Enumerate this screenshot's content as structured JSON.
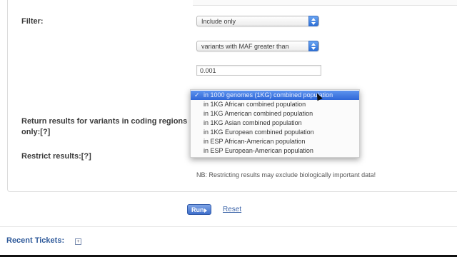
{
  "form": {
    "filter_label": "Filter:",
    "filter_mode_value": "Include only",
    "filter_field_value": "variants with MAF greater than",
    "maf_threshold_value": "0.001",
    "coding_label": "Return results for variants in coding regions only:",
    "restrict_label": "Restrict results:",
    "help_marker": "[?]",
    "restrict_note": "NB: Restricting results may exclude biologically important data!"
  },
  "population_dropdown": {
    "selected_index": 0,
    "options": [
      "in 1000 genomes (1KG) combined population",
      "in 1KG African combined population",
      "in 1KG American combined population",
      "in 1KG Asian combined population",
      "in 1KG European combined population",
      "in ESP African-American population",
      "in ESP European-American population"
    ]
  },
  "actions": {
    "run_label": "Run",
    "reset_label": "Reset"
  },
  "footer": {
    "recent_tickets_label": "Recent Tickets:",
    "toggle_icon": "expand-icon"
  }
}
